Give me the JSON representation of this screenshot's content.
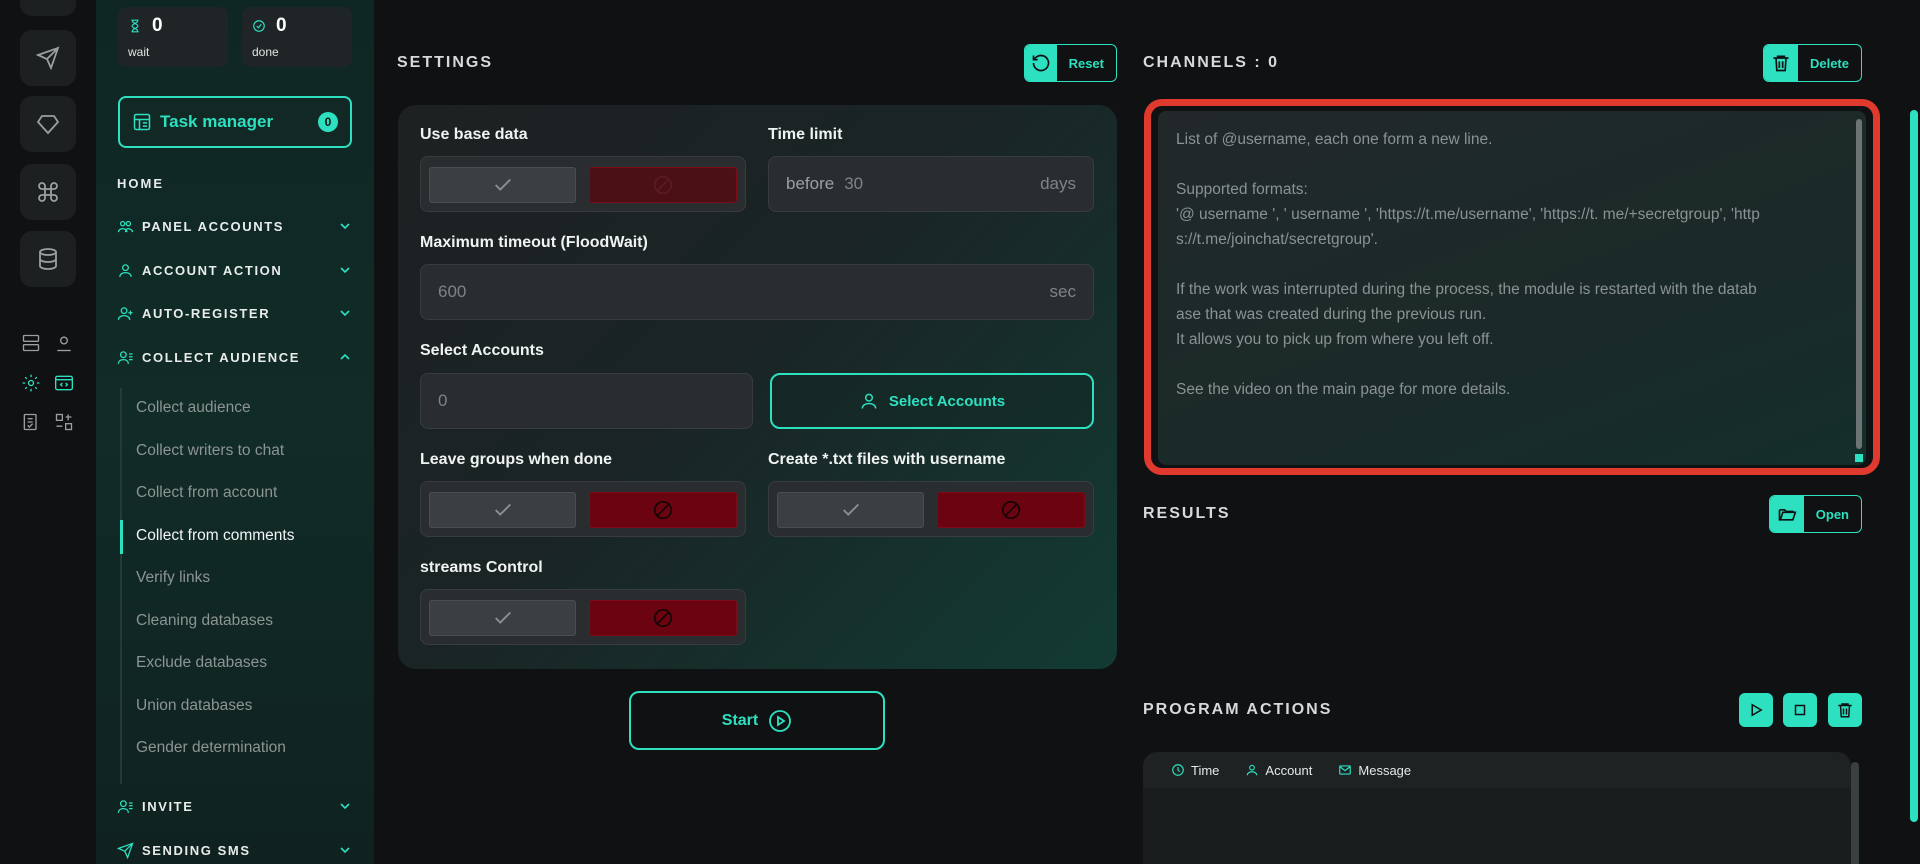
{
  "counters": {
    "wait_value": "0",
    "wait_label": "wait",
    "done_value": "0",
    "done_label": "done"
  },
  "task_manager": {
    "label": "Task manager",
    "badge": "0"
  },
  "nav": {
    "home": "HOME",
    "sections": [
      {
        "label": "PANEL ACCOUNTS"
      },
      {
        "label": "ACCOUNT ACTION"
      },
      {
        "label": "AUTO-REGISTER"
      },
      {
        "label": "COLLECT AUDIENCE"
      },
      {
        "label": "INVITE"
      },
      {
        "label": "SENDING SMS"
      }
    ],
    "subitems": [
      "Collect audience",
      "Collect writers to chat",
      "Collect from account",
      "Collect from comments",
      "Verify links",
      "Cleaning databases",
      "Exclude databases",
      "Union databases",
      "Gender determination"
    ]
  },
  "settings": {
    "title": "SETTINGS",
    "reset_label": "Reset",
    "use_base_data": "Use base data",
    "time_limit": "Time limit",
    "time_before": "before",
    "time_value": "30",
    "time_unit": "days",
    "max_timeout": "Maximum timeout (FloodWait)",
    "timeout_value": "600",
    "timeout_unit": "sec",
    "select_accounts": "Select Accounts",
    "accounts_value": "0",
    "select_accounts_btn": "Select Accounts",
    "leave_groups": "Leave groups when done",
    "create_txt": "Create *.txt files with username",
    "streams_control": "streams Control",
    "start_label": "Start"
  },
  "channels": {
    "title": "CHANNELS : 0",
    "delete_label": "Delete",
    "placeholder_lines": [
      "List of @username, each one form a new line.",
      "",
      "Supported formats:",
      "'@ username ', ' username ', 'https://t.me/username', 'https://t. me/+secretgroup', 'http",
      "s://t.me/joinchat/secretgroup'.",
      "",
      "If the work was interrupted during the process, the module is restarted with the datab",
      "ase that was created during the previous run.",
      "It allows you to pick up from where you left off.",
      "",
      "See the video on the main page for more details."
    ]
  },
  "results": {
    "title": "RESULTS",
    "open_label": "Open"
  },
  "program_actions": {
    "title": "PROGRAM ACTIONS",
    "columns": {
      "time": "Time",
      "account": "Account",
      "message": "Message"
    }
  },
  "colors": {
    "accent": "#2de0c0",
    "danger": "#6b0410",
    "highlight": "#e0392e"
  }
}
